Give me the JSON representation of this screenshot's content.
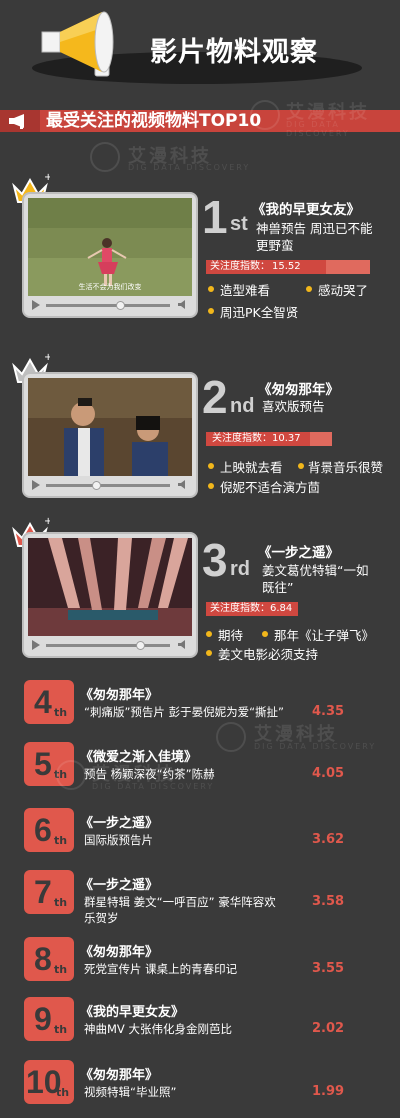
{
  "header": {
    "title": "影片物料观察"
  },
  "section": {
    "title": "最受关注的视频物料TOP10"
  },
  "watermark": {
    "name": "艾漫科技",
    "sub": "DIG DATA DISCOVERY"
  },
  "index_label": "关注度指数：",
  "top3": [
    {
      "rank": "1",
      "suffix": "st",
      "title": "《我的早更女友》",
      "desc": [
        "神兽预告 周迅已不能",
        "更野蛮"
      ],
      "index": "15.52",
      "subtitle": "生活不会为我们改变",
      "tags": [
        "造型难看",
        "感动哭了",
        "周迅PK全智贤"
      ]
    },
    {
      "rank": "2",
      "suffix": "nd",
      "title": "《匆匆那年》",
      "desc": [
        "喜欢版预告"
      ],
      "index": "10.37",
      "tags": [
        "上映就去看",
        "背景音乐很赞",
        "倪妮不适合演方茴"
      ]
    },
    {
      "rank": "3",
      "suffix": "rd",
      "title": "《一步之遥》",
      "desc": [
        "姜文葛优特辑“一如",
        "既往”"
      ],
      "index": "6.84",
      "tags": [
        "期待",
        "那年《让子弹飞》",
        "姜文电影必须支持"
      ]
    }
  ],
  "list": [
    {
      "rank": "4",
      "suffix": "th",
      "title": "《匆匆那年》",
      "desc": [
        "“刺痛版”预告片  彭于晏倪妮为爱“撕扯”"
      ],
      "value": "4.35"
    },
    {
      "rank": "5",
      "suffix": "th",
      "title": "《微爱之渐入佳境》",
      "desc": [
        "预告  杨颖深夜“约茶”陈赫"
      ],
      "value": "4.05"
    },
    {
      "rank": "6",
      "suffix": "th",
      "title": "《一步之遥》",
      "desc": [
        "国际版预告片"
      ],
      "value": "3.62"
    },
    {
      "rank": "7",
      "suffix": "th",
      "title": "《一步之遥》",
      "desc": [
        "群星特辑  姜文“一呼百应”  豪华阵容欢",
        "乐贺岁"
      ],
      "value": "3.58"
    },
    {
      "rank": "8",
      "suffix": "th",
      "title": "《匆匆那年》",
      "desc": [
        "死党宣传片  课桌上的青春印记"
      ],
      "value": "3.55"
    },
    {
      "rank": "9",
      "suffix": "th",
      "title": "《我的早更女友》",
      "desc": [
        "神曲MV  大张伟化身金刚芭比"
      ],
      "value": "2.02"
    },
    {
      "rank": "10",
      "suffix": "th",
      "title": "《匆匆那年》",
      "desc": [
        "视频特辑“毕业照”"
      ],
      "value": "1.99"
    }
  ]
}
